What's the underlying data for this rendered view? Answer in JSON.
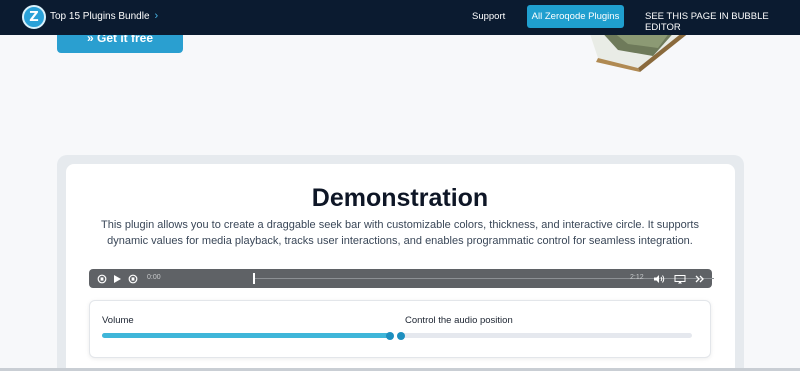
{
  "header": {
    "logo_text": "Z",
    "bundle_label": "Top 15 Plugins Bundle",
    "nav": {
      "support": "Support",
      "plugins": "All Zeroqode Plugins",
      "editor": "SEE THIS PAGE IN BUBBLE EDITOR"
    }
  },
  "hero": {
    "cta_label": "» Get it free"
  },
  "demo": {
    "title": "Demonstration",
    "description": "This plugin allows you to create a draggable seek bar with customizable colors, thickness, and interactive circle. It supports dynamic values for media playback, tracks user interactions, and enables programmatic control for seamless integration."
  },
  "player": {
    "current_time": "0:00",
    "duration": "2:12",
    "position_fraction": 0,
    "icons": [
      "rewind-icon",
      "play-icon",
      "forward-icon",
      "volume-icon",
      "cast-icon",
      "next-icon"
    ]
  },
  "sliders": {
    "volume": {
      "label": "Volume",
      "level": 0.99
    },
    "position": {
      "label": "Control the audio position",
      "level": 0.0
    }
  },
  "colors": {
    "header_bg": "#0b1b30",
    "accent": "#1f9fcf",
    "slider_fill": "#3fb6d9"
  }
}
